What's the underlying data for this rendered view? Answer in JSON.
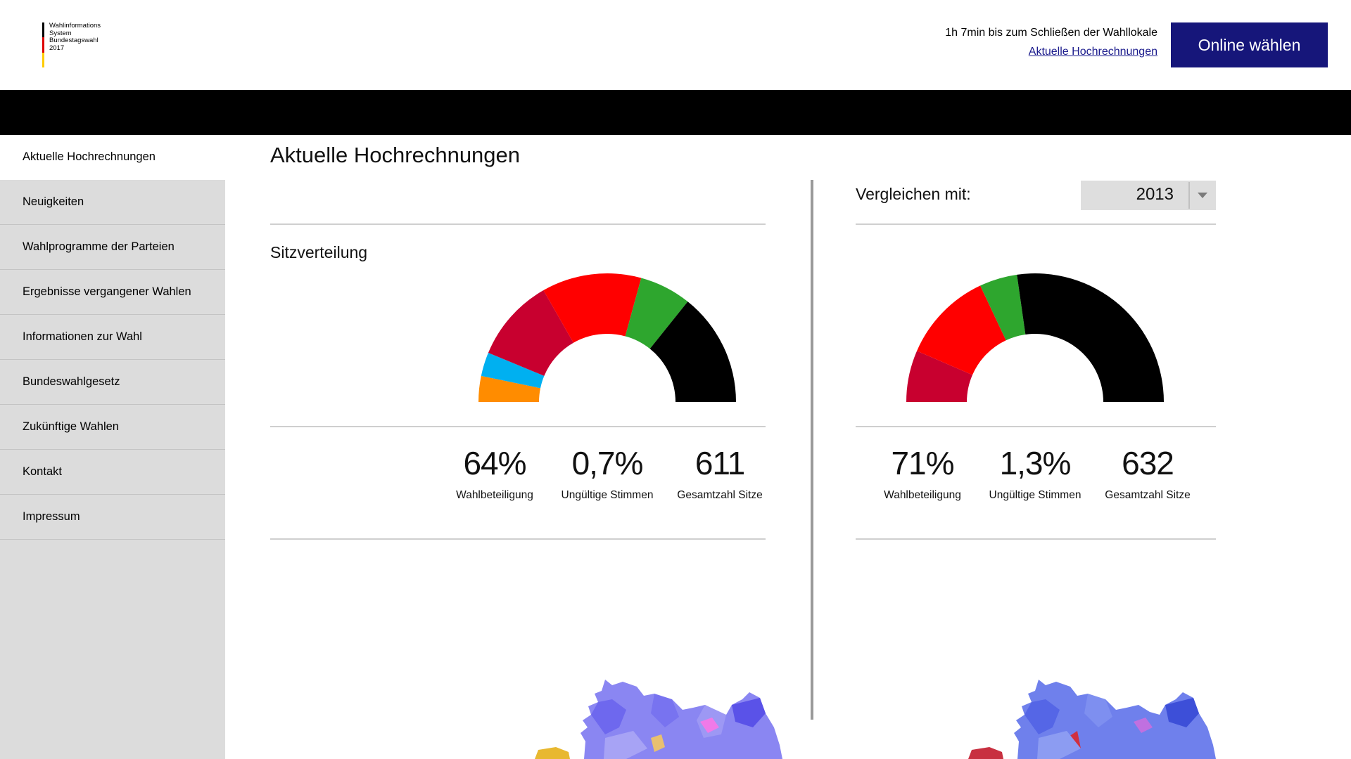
{
  "header": {
    "logo_lines": [
      "Wahlinformations",
      "System",
      "Bundestagswahl",
      "2017"
    ],
    "countdown": "1h 7min bis zum Schließen der Wahllokale",
    "link": "Aktuelle Hochrechnungen",
    "cta": "Online wählen"
  },
  "sidebar": {
    "items": [
      {
        "label": "Aktuelle Hochrechnungen",
        "active": true
      },
      {
        "label": "Neuigkeiten"
      },
      {
        "label": "Wahlprogramme der Parteien"
      },
      {
        "label": "Ergebnisse vergangener Wahlen"
      },
      {
        "label": "Informationen zur Wahl"
      },
      {
        "label": "Bundeswahlgesetz"
      },
      {
        "label": "Zukünftige Wahlen"
      },
      {
        "label": "Kontakt"
      },
      {
        "label": "Impressum"
      }
    ]
  },
  "main": {
    "title": "Aktuelle Hochrechnungen",
    "section_label": "Sitzverteilung",
    "compare_label": "Vergleichen mit:",
    "compare_year": "2013",
    "current": {
      "stats": [
        {
          "value": "64%",
          "label": "Wahlbeteiligung"
        },
        {
          "value": "0,7%",
          "label": "Ungültige Stimmen"
        },
        {
          "value": "611",
          "label": "Gesamtzahl Sitze"
        }
      ]
    },
    "compare": {
      "stats": [
        {
          "value": "71%",
          "label": "Wahlbeteiligung"
        },
        {
          "value": "1,3%",
          "label": "Ungültige Stimmen"
        },
        {
          "value": "632",
          "label": "Gesamtzahl Sitze"
        }
      ]
    }
  },
  "chart_data": [
    {
      "type": "pie",
      "shape": "semicircle",
      "colors": [
        "#ff8c00",
        "#00b0f0",
        "#c8002f",
        "#ff0000",
        "#2ea62e",
        "#000000"
      ],
      "values": [
        6.5,
        6,
        21,
        25,
        13,
        28.5
      ]
    },
    {
      "type": "pie",
      "shape": "semicircle",
      "colors": [
        "#c8002f",
        "#ff0000",
        "#2ea62e",
        "#000000"
      ],
      "values": [
        13,
        23,
        9.5,
        54.5
      ]
    }
  ],
  "colors": {
    "cta": "#16167a",
    "link": "#1a1a8c",
    "sidebar": "#dcdcdc"
  }
}
